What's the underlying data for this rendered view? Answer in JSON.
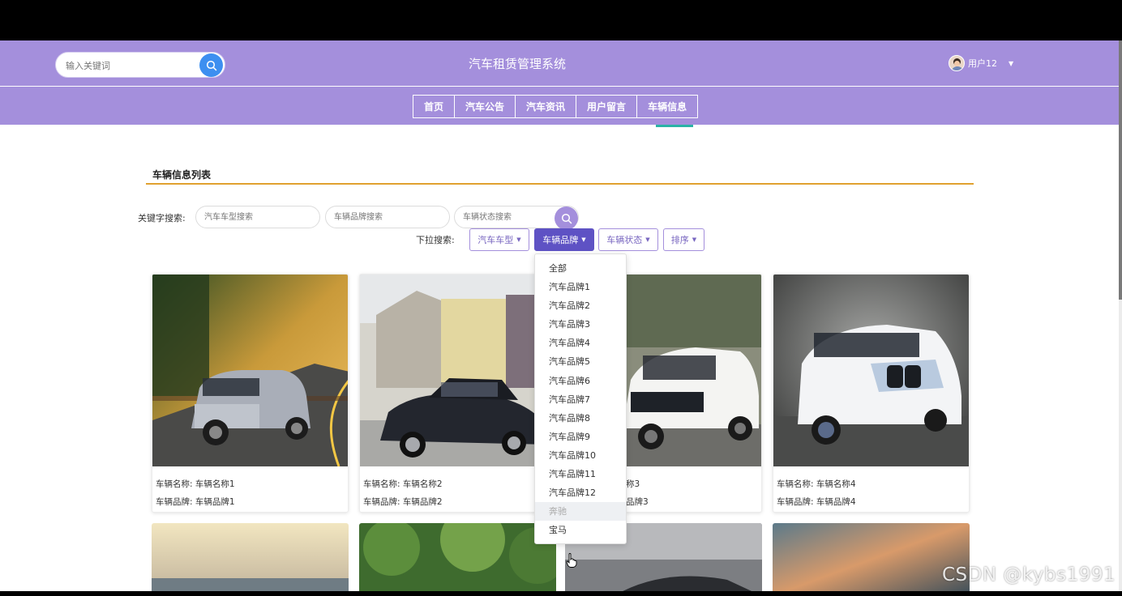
{
  "header": {
    "search_placeholder": "输入关键词",
    "site_title": "汽车租赁管理系统",
    "user_name": "用户12"
  },
  "nav": {
    "items": [
      {
        "label": "首页"
      },
      {
        "label": "汽车公告"
      },
      {
        "label": "汽车资讯"
      },
      {
        "label": "用户留言"
      },
      {
        "label": "车辆信息"
      }
    ],
    "active": "车辆信息"
  },
  "section": {
    "title": "车辆信息列表"
  },
  "filters": {
    "keyword_label": "关键字搜索:",
    "inputs": [
      {
        "placeholder": "汽车车型搜索"
      },
      {
        "placeholder": "车辆品牌搜索"
      },
      {
        "placeholder": "车辆状态搜索"
      }
    ],
    "dropdown_label": "下拉搜索:",
    "dropdowns": [
      {
        "label": "汽车车型"
      },
      {
        "label": "车辆品牌"
      },
      {
        "label": "车辆状态"
      },
      {
        "label": "排序"
      }
    ],
    "active_dropdown": "车辆品牌"
  },
  "brand_menu": {
    "options": [
      "全部",
      "汽车品牌1",
      "汽车品牌2",
      "汽车品牌3",
      "汽车品牌4",
      "汽车品牌5",
      "汽车品牌6",
      "汽车品牌7",
      "汽车品牌8",
      "汽车品牌9",
      "汽车品牌10",
      "汽车品牌11",
      "汽车品牌12",
      "奔驰",
      "宝马"
    ],
    "hovered": "奔驰"
  },
  "cards": [
    {
      "name_line": "车辆名称: 车辆名称1",
      "brand_line": "车辆品牌: 车辆品牌1"
    },
    {
      "name_line": "车辆名称: 车辆名称2",
      "brand_line": "车辆品牌: 车辆品牌2"
    },
    {
      "name_line": "称3",
      "brand_line": "品牌3"
    },
    {
      "name_line": "车辆名称: 车辆名称4",
      "brand_line": "车辆品牌: 车辆品牌4"
    }
  ],
  "watermark": "CSDN @kybs1991",
  "colors": {
    "header_bg": "#a48fdc",
    "accent_button": "#5e52c4",
    "search_button": "#3d8ff0",
    "section_underline": "#e0a12f",
    "nav_active_underline": "#2ab2a6"
  },
  "icons": {
    "search": "search-icon",
    "caret": "caret-down-icon",
    "avatar": "user-avatar",
    "cursor": "hand-cursor-icon"
  }
}
